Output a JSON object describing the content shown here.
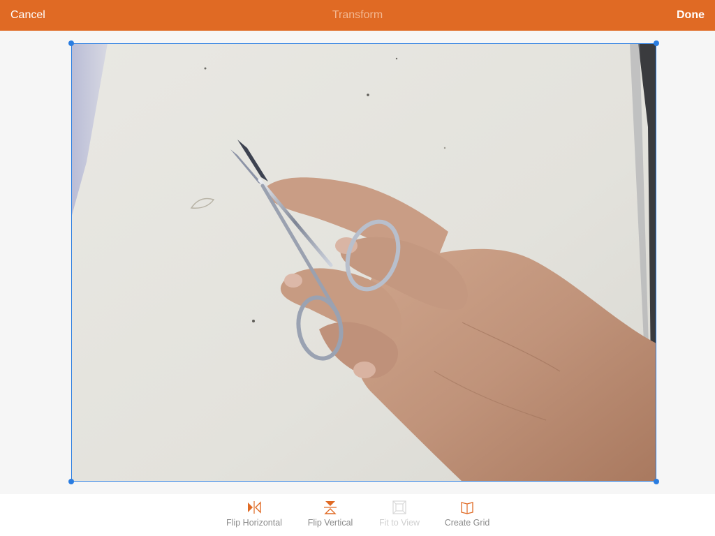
{
  "header": {
    "cancel_label": "Cancel",
    "title": "Transform",
    "done_label": "Done"
  },
  "toolbar": {
    "flip_horizontal_label": "Flip Horizontal",
    "flip_vertical_label": "Flip Vertical",
    "fit_to_view_label": "Fit to View",
    "create_grid_label": "Create Grid"
  },
  "colors": {
    "header_bg": "#e06a24",
    "accent_icon": "#e06a24",
    "crop_frame": "#2a7de1",
    "disabled": "#cfcfcf"
  },
  "icons": {
    "flip_horizontal": "flip-horizontal-icon",
    "flip_vertical": "flip-vertical-icon",
    "fit_to_view": "fit-to-view-icon",
    "create_grid": "create-grid-icon"
  }
}
